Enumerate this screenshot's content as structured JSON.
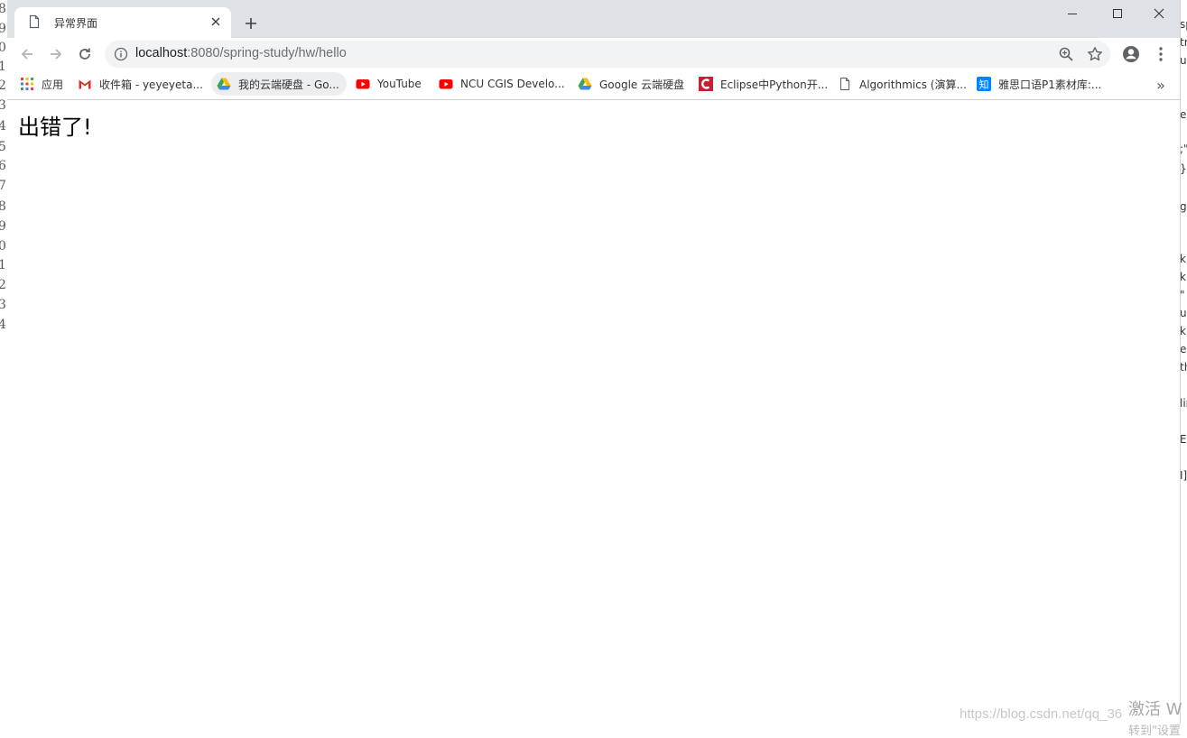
{
  "tab": {
    "title": "异常界面"
  },
  "address_bar": {
    "host": "localhost",
    "path": ":8080/spring-study/hw/hello"
  },
  "bookmarks": [
    {
      "label": "应用",
      "icon": "apps-grid-icon"
    },
    {
      "label": "收件箱 - yeyeyeta...",
      "icon": "gmail-icon"
    },
    {
      "label": "我的云端硬盘 - Go...",
      "icon": "google-drive-icon"
    },
    {
      "label": "YouTube",
      "icon": "youtube-icon"
    },
    {
      "label": "NCU CGIS Develo...",
      "icon": "youtube-icon"
    },
    {
      "label": "Google 云端硬盘",
      "icon": "google-drive-icon"
    },
    {
      "label": "Eclipse中Python开...",
      "icon": "csdn-icon"
    },
    {
      "label": "Algorithmics (演算...",
      "icon": "page-icon"
    },
    {
      "label": "雅思口语P1素材库:...",
      "icon": "zhihu-icon"
    }
  ],
  "page": {
    "heading": "出错了!"
  },
  "overlay": {
    "watermark": "https://blog.csdn.net/qq_36",
    "activate": "激活 W",
    "activate_sub": "转到\"设置"
  },
  "background_editor": {
    "line_numbers": [
      "8",
      "9",
      "0",
      "1",
      "2",
      "3",
      "4",
      "5",
      "6",
      "7",
      "8",
      "9",
      "0",
      "1",
      "2",
      "3",
      "4"
    ],
    "right_fragments": [
      "sp",
      "tr",
      "u",
      "e",
      ";\"",
      "}\"",
      "g",
      "ki",
      "ki",
      "\"",
      "u",
      "ki",
      "er",
      "th",
      "lin",
      "EX",
      "I]"
    ]
  },
  "colors": {
    "tabstrip": "#dee1e6",
    "omnibox": "#f1f3f4",
    "youtube_red": "#ff0000",
    "gmail_red": "#d93025",
    "csdn_red": "#c32136",
    "zhihu_blue": "#0084ff"
  }
}
